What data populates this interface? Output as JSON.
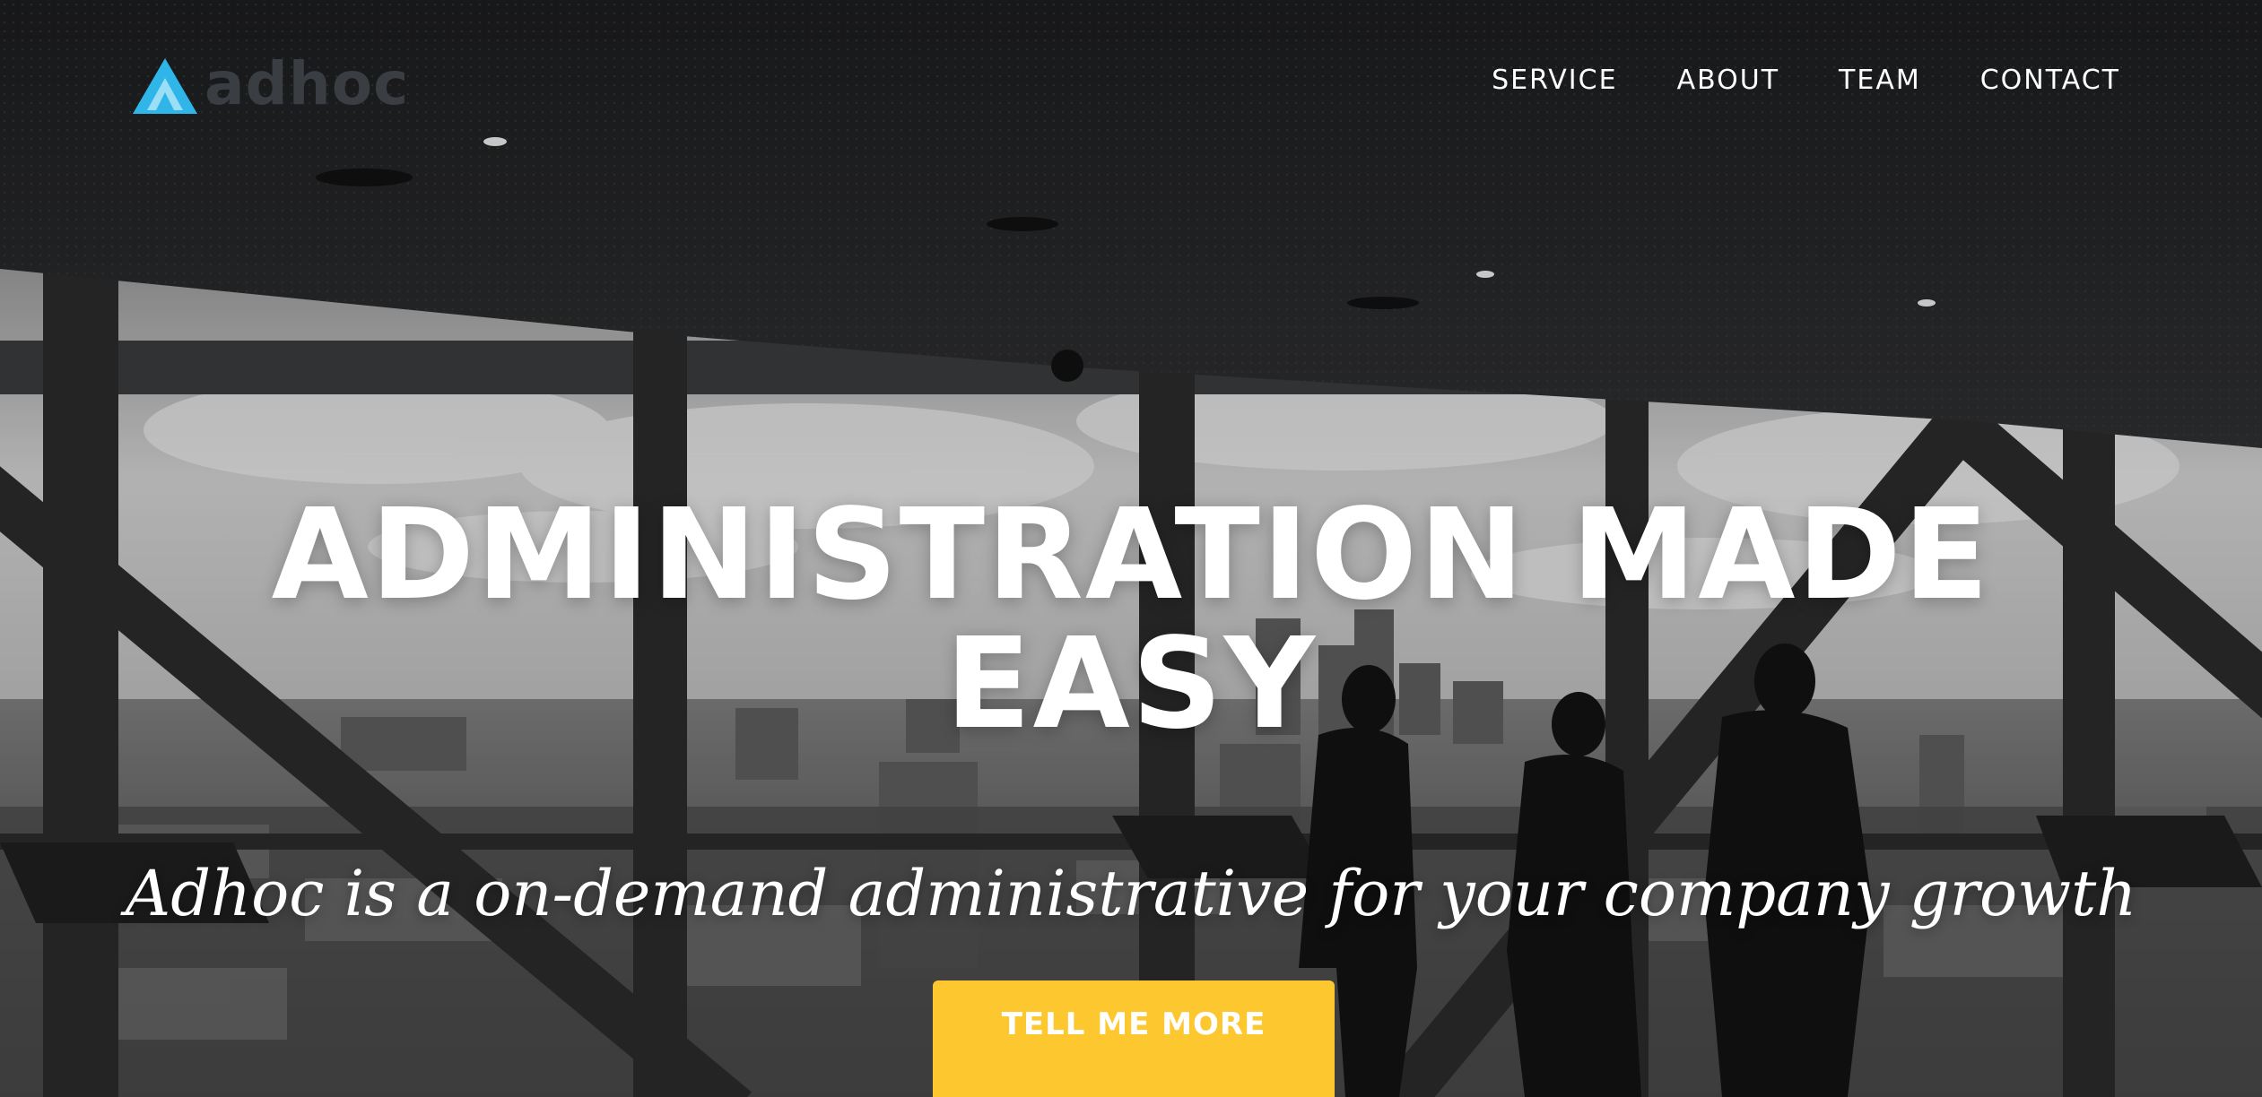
{
  "brand": {
    "name": "adhoc",
    "accent_color": "#2fb5e8",
    "logo_icon": "triangle-logo-icon"
  },
  "nav": {
    "items": [
      {
        "label": "SERVICE"
      },
      {
        "label": "ABOUT"
      },
      {
        "label": "TEAM"
      },
      {
        "label": "CONTACT"
      }
    ]
  },
  "hero": {
    "heading": "ADMINISTRATION MADE EASY",
    "subheading": "Adhoc is a on-demand administrative for your company growth",
    "cta_label": "TELL ME MORE",
    "cta_color": "#fcc72f",
    "background": "grayscale office interior with city skyline through windows and three silhouetted people"
  }
}
